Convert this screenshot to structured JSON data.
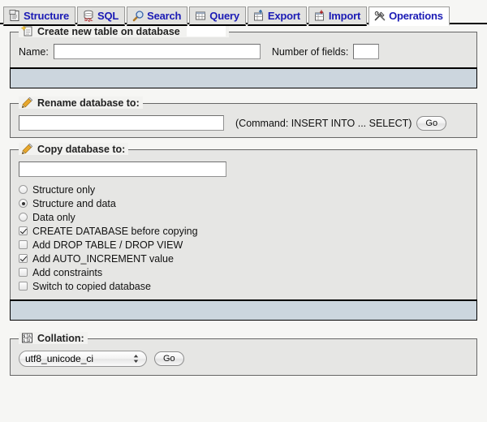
{
  "tabs": [
    {
      "label": "Structure",
      "icon": "structure-icon",
      "active": false
    },
    {
      "label": "SQL",
      "icon": "sql-icon",
      "active": false
    },
    {
      "label": "Search",
      "icon": "search-icon",
      "active": false
    },
    {
      "label": "Query",
      "icon": "query-icon",
      "active": false
    },
    {
      "label": "Export",
      "icon": "export-icon",
      "active": false
    },
    {
      "label": "Import",
      "icon": "import-icon",
      "active": false
    },
    {
      "label": "Operations",
      "icon": "operations-icon",
      "active": true
    }
  ],
  "create_table": {
    "legend": "Create new table on database",
    "database_name": "",
    "name_label": "Name:",
    "name_value": "",
    "fields_label": "Number of fields:",
    "fields_value": ""
  },
  "rename": {
    "legend": "Rename database to:",
    "value": "",
    "command_note": "(Command: INSERT INTO ... SELECT)",
    "go_label": "Go"
  },
  "copy": {
    "legend": "Copy database to:",
    "value": "",
    "radios": [
      {
        "label": "Structure only",
        "checked": false
      },
      {
        "label": "Structure and data",
        "checked": true
      },
      {
        "label": "Data only",
        "checked": false
      }
    ],
    "checkboxes": [
      {
        "label": "CREATE DATABASE before copying",
        "checked": true
      },
      {
        "label": "Add DROP TABLE / DROP VIEW",
        "checked": false
      },
      {
        "label": "Add AUTO_INCREMENT value",
        "checked": true
      },
      {
        "label": "Add constraints",
        "checked": false
      },
      {
        "label": "Switch to copied database",
        "checked": false
      }
    ]
  },
  "collation": {
    "legend": "Collation:",
    "selected": "utf8_unicode_ci",
    "options": [
      "utf8_unicode_ci"
    ],
    "go_label": "Go"
  },
  "colors": {
    "tab_text": "#1b1bb5",
    "panel_bg": "#e6e6e4",
    "footer_bar": "#ccd6de",
    "page_bg": "#f6f6f4"
  }
}
